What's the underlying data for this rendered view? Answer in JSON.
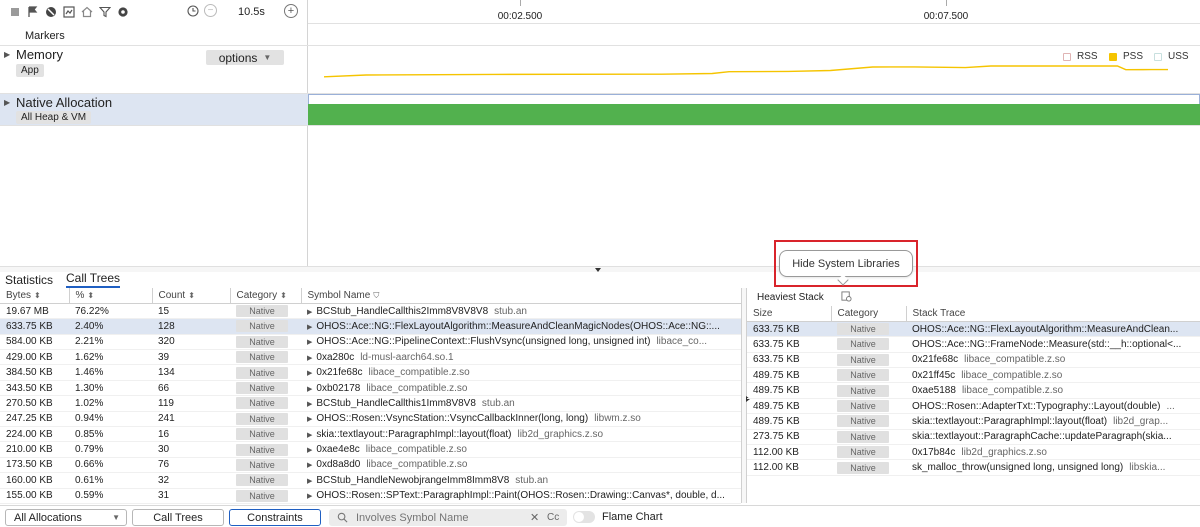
{
  "toolbar": {
    "time_range": "10.5s",
    "icons": [
      "stop-icon",
      "flag-icon",
      "block-icon",
      "screenshot-icon",
      "home-icon",
      "filter-icon",
      "settings-icon",
      "clock-icon",
      "zoom-out-icon",
      "zoom-in-icon"
    ]
  },
  "ruler": {
    "ticks": [
      "00:02.500",
      "00:07.500"
    ]
  },
  "tracks": {
    "markers": "Markers",
    "memory": {
      "title": "Memory",
      "tag": "App",
      "options_label": "options"
    },
    "native": {
      "title": "Native Allocation",
      "tag": "All Heap & VM"
    }
  },
  "legend": [
    {
      "name": "RSS",
      "color": "#e0b4b4",
      "filled": false
    },
    {
      "name": "PSS",
      "color": "#f5c400",
      "filled": true
    },
    {
      "name": "USS",
      "color": "#c8e0df",
      "filled": false
    }
  ],
  "memory_series": {
    "color": "#f5c400",
    "points": [
      [
        0.0,
        0.82
      ],
      [
        0.05,
        0.72
      ],
      [
        0.2,
        0.69
      ],
      [
        0.4,
        0.68
      ],
      [
        0.46,
        0.64
      ],
      [
        0.48,
        0.54
      ],
      [
        0.55,
        0.52
      ],
      [
        0.6,
        0.47
      ],
      [
        0.65,
        0.28
      ],
      [
        0.7,
        0.27
      ],
      [
        0.76,
        0.31
      ],
      [
        0.79,
        0.22
      ],
      [
        0.86,
        0.22
      ],
      [
        0.94,
        0.22
      ],
      [
        0.95,
        0.43
      ],
      [
        0.98,
        0.42
      ],
      [
        1.0,
        0.42
      ]
    ]
  },
  "native_bar_color": "#52b14e",
  "subtabs": [
    "Statistics",
    "Call Trees"
  ],
  "active_subtab": "Call Trees",
  "tooltip": "Hide System Libraries",
  "main_table": {
    "headers": [
      "Bytes",
      "%",
      "Count",
      "Category",
      "Symbol Name"
    ],
    "rows": [
      {
        "bytes": "19.67 MB",
        "pct": "76.22%",
        "count": "15",
        "category": "Native",
        "symbol": "BCStub_HandleCallthis2Imm8V8V8V8",
        "lib": "stub.an"
      },
      {
        "bytes": "633.75 KB",
        "pct": "2.40%",
        "count": "128",
        "category": "Native",
        "symbol": "OHOS::Ace::NG::FlexLayoutAlgorithm::MeasureAndCleanMagicNodes(OHOS::Ace::NG::...",
        "lib": ""
      },
      {
        "bytes": "584.00 KB",
        "pct": "2.21%",
        "count": "320",
        "category": "Native",
        "symbol": "OHOS::Ace::NG::PipelineContext::FlushVsync(unsigned long, unsigned int)",
        "lib": "libace_co..."
      },
      {
        "bytes": "429.00 KB",
        "pct": "1.62%",
        "count": "39",
        "category": "Native",
        "symbol": "0xa280c",
        "lib": "ld-musl-aarch64.so.1"
      },
      {
        "bytes": "384.50 KB",
        "pct": "1.46%",
        "count": "134",
        "category": "Native",
        "symbol": "0x21fe68c",
        "lib": "libace_compatible.z.so"
      },
      {
        "bytes": "343.50 KB",
        "pct": "1.30%",
        "count": "66",
        "category": "Native",
        "symbol": "0xb02178",
        "lib": "libace_compatible.z.so"
      },
      {
        "bytes": "270.50 KB",
        "pct": "1.02%",
        "count": "119",
        "category": "Native",
        "symbol": "BCStub_HandleCallthis1Imm8V8V8",
        "lib": "stub.an"
      },
      {
        "bytes": "247.25 KB",
        "pct": "0.94%",
        "count": "241",
        "category": "Native",
        "symbol": "OHOS::Rosen::VsyncStation::VsyncCallbackInner(long, long)",
        "lib": "libwm.z.so"
      },
      {
        "bytes": "224.00 KB",
        "pct": "0.85%",
        "count": "16",
        "category": "Native",
        "symbol": "skia::textlayout::ParagraphImpl::layout(float)",
        "lib": "lib2d_graphics.z.so"
      },
      {
        "bytes": "210.00 KB",
        "pct": "0.79%",
        "count": "30",
        "category": "Native",
        "symbol": "0xae4e8c",
        "lib": "libace_compatible.z.so"
      },
      {
        "bytes": "173.50 KB",
        "pct": "0.66%",
        "count": "76",
        "category": "Native",
        "symbol": "0xd8a8d0",
        "lib": "libace_compatible.z.so"
      },
      {
        "bytes": "160.00 KB",
        "pct": "0.61%",
        "count": "32",
        "category": "Native",
        "symbol": "BCStub_HandleNewobjrangeImm8Imm8V8",
        "lib": "stub.an"
      },
      {
        "bytes": "155.00 KB",
        "pct": "0.59%",
        "count": "31",
        "category": "Native",
        "symbol": "OHOS::Rosen::SPText::ParagraphImpl::Paint(OHOS::Rosen::Drawing::Canvas*, double, d...",
        "lib": ""
      }
    ]
  },
  "heaviest": {
    "title": "Heaviest Stack",
    "headers": [
      "Size",
      "Category",
      "Stack Trace"
    ],
    "rows": [
      {
        "size": "633.75 KB",
        "category": "Native",
        "trace": "OHOS::Ace::NG::FlexLayoutAlgorithm::MeasureAndClean...",
        "lib": ""
      },
      {
        "size": "633.75 KB",
        "category": "Native",
        "trace": "OHOS::Ace::NG::FrameNode::Measure(std::__h::optional<...",
        "lib": ""
      },
      {
        "size": "633.75 KB",
        "category": "Native",
        "trace": "0x21fe68c",
        "lib": "libace_compatible.z.so"
      },
      {
        "size": "489.75 KB",
        "category": "Native",
        "trace": "0x21ff45c",
        "lib": "libace_compatible.z.so"
      },
      {
        "size": "489.75 KB",
        "category": "Native",
        "trace": "0xae5188",
        "lib": "libace_compatible.z.so"
      },
      {
        "size": "489.75 KB",
        "category": "Native",
        "trace": "OHOS::Rosen::AdapterTxt::Typography::Layout(double)",
        "lib": "..."
      },
      {
        "size": "489.75 KB",
        "category": "Native",
        "trace": "skia::textlayout::ParagraphImpl::layout(float)",
        "lib": "lib2d_grap..."
      },
      {
        "size": "273.75 KB",
        "category": "Native",
        "trace": "skia::textlayout::ParagraphCache::updateParagraph(skia...",
        "lib": ""
      },
      {
        "size": "112.00 KB",
        "category": "Native",
        "trace": "0x17b84c",
        "lib": "lib2d_graphics.z.so"
      },
      {
        "size": "112.00 KB",
        "category": "Native",
        "trace": "sk_malloc_throw(unsigned long, unsigned long)",
        "lib": "libskia..."
      }
    ]
  },
  "footer": {
    "allocations_select": "All Allocations",
    "call_trees_button": "Call Trees",
    "constraints_button": "Constraints",
    "search_placeholder": "Involves Symbol Name",
    "case_label": "Cc",
    "flame_chart_label": "Flame Chart"
  }
}
